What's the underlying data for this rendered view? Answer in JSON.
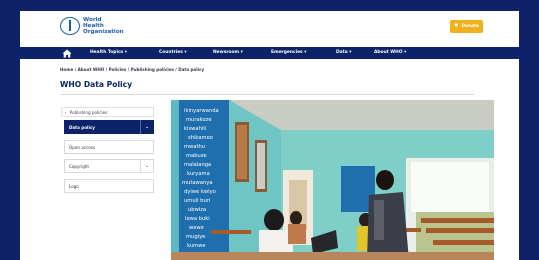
{
  "header": {
    "logo_line1": "World Health",
    "logo_line2": "Organization",
    "donate_label": "Donate"
  },
  "nav": {
    "items": [
      {
        "label": "Health Topics ▾"
      },
      {
        "label": "Countries ▾"
      },
      {
        "label": "Newsroom ▾"
      },
      {
        "label": "Emergencies ▾"
      },
      {
        "label": "Data ▾"
      },
      {
        "label": "About WHO ▾"
      }
    ]
  },
  "breadcrumb": "Home / About WHO / Policies / Publishing policies / Data policy",
  "page_title": "WHO Data Policy",
  "sidenav": {
    "back_label": "Publishing policies",
    "items": [
      {
        "label": "Data policy"
      },
      {
        "label": "Open access"
      },
      {
        "label": "Copyright"
      },
      {
        "label": "Logo"
      }
    ]
  },
  "photo": {
    "wall_words": [
      "ikinyarwanda",
      "murakoze",
      "kiswahili",
      "shikamoo",
      "mwathu",
      "mabuze",
      "malalanga",
      "kuryama",
      "mutawanya",
      "dyiwe kwiyo",
      "umuli buri",
      "ubwiza",
      "lewa buki",
      "wewe",
      "mugiye",
      "kumwe"
    ]
  },
  "colors": {
    "navy": "#0c2369",
    "background": "#0f2268",
    "donate": "#f1b11c",
    "wall": "#62bfc6"
  }
}
